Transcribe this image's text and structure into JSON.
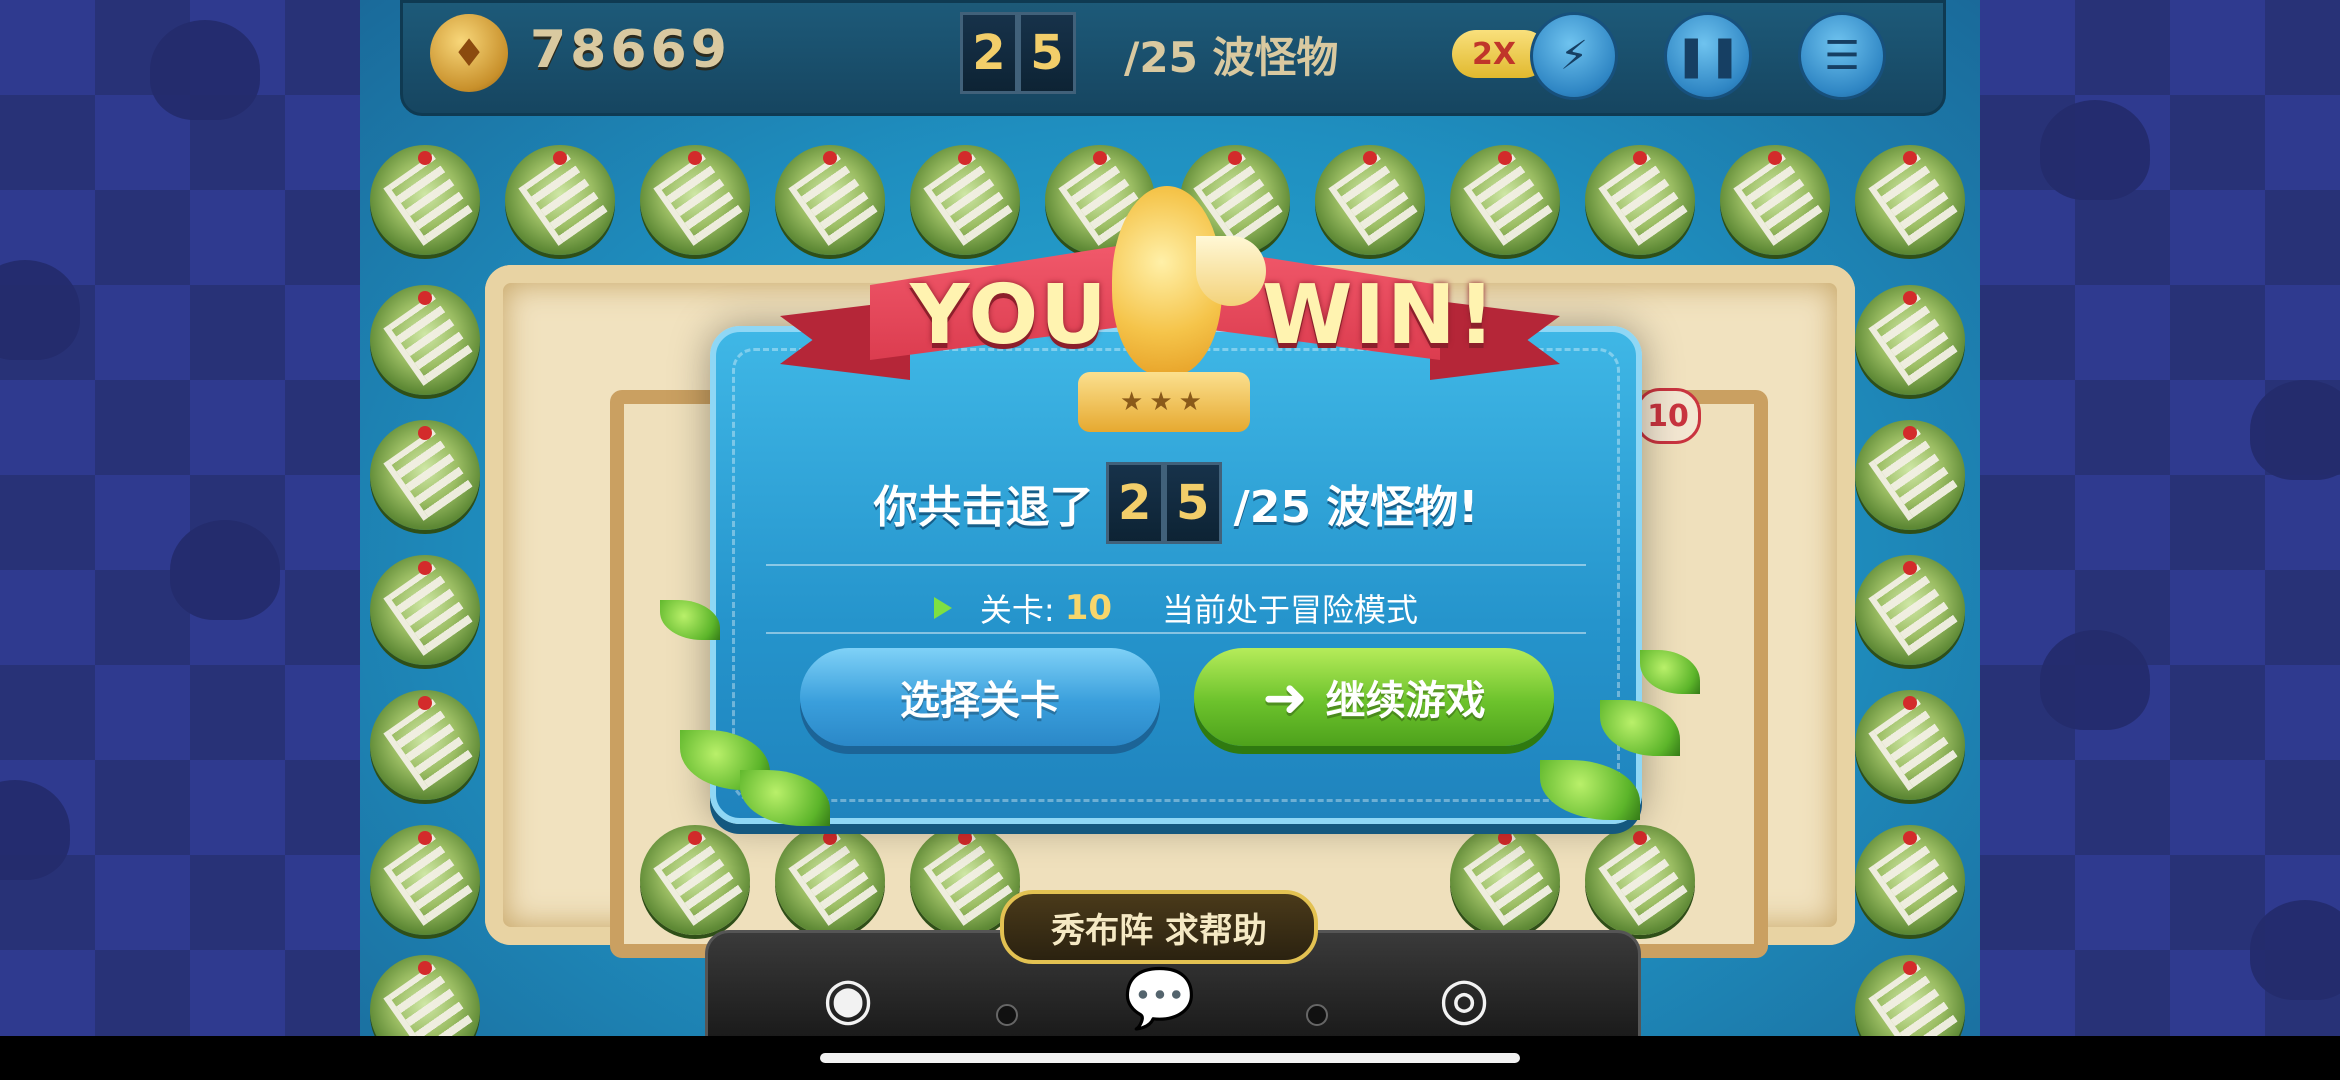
{
  "hud": {
    "gold": "78669",
    "wave_digits": [
      "2",
      "5"
    ],
    "wave_total": "/25 波怪物",
    "speed": "2X"
  },
  "dialog": {
    "title_left": "YOU",
    "title_right": "WIN!",
    "stars": "★★★",
    "result_prefix": "你共击退了",
    "result_digits": [
      "2",
      "5"
    ],
    "result_suffix": "/25 波怪物!",
    "level_label": "关卡:",
    "level_value": "10",
    "mode_text": "当前处于冒险模式",
    "select_level_button": "选择关卡",
    "continue_button": "继续游戏"
  },
  "share": {
    "label": "秀布阵 求帮助"
  },
  "background": {
    "tower_level_badge": "10"
  },
  "colors": {
    "ribbon": "#d63548",
    "dialog": "#2594cc",
    "continue": "#6cc22c",
    "gold_text": "#f2ce6a"
  }
}
